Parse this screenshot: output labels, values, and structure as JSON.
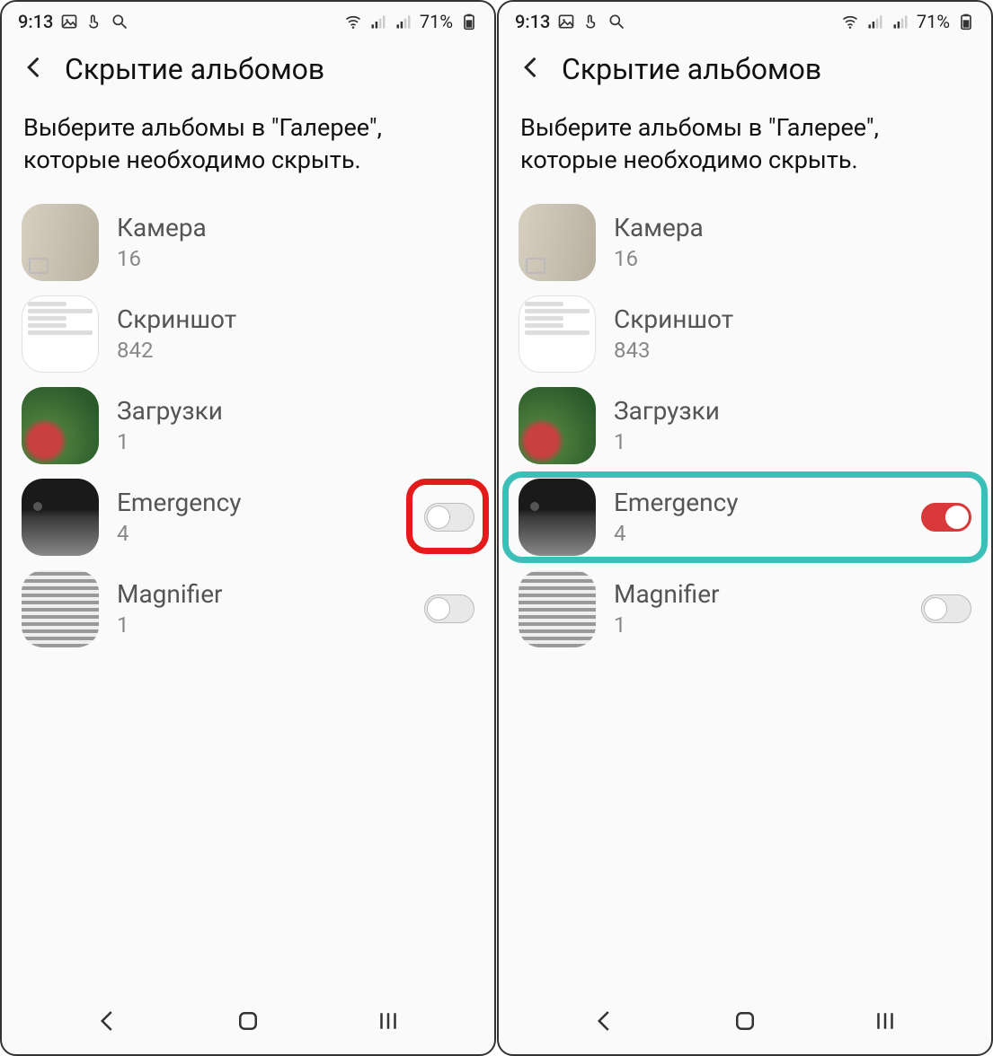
{
  "left": {
    "statusbar": {
      "time": "9:13",
      "battery": "71%"
    },
    "title": "Скрытие альбомов",
    "subtitle": "Выберите альбомы в \"Галерее\", которые необходимо скрыть.",
    "albums": [
      {
        "name": "Камера",
        "count": "16",
        "thumb": "camera",
        "toggle": null
      },
      {
        "name": "Скриншот",
        "count": "842",
        "thumb": "screenshot",
        "toggle": null
      },
      {
        "name": "Загрузки",
        "count": "1",
        "thumb": "downloads",
        "toggle": null
      },
      {
        "name": "Emergency",
        "count": "4",
        "thumb": "emergency",
        "toggle": "off"
      },
      {
        "name": "Magnifier",
        "count": "1",
        "thumb": "magnifier",
        "toggle": "off"
      }
    ]
  },
  "right": {
    "statusbar": {
      "time": "9:13",
      "battery": "71%"
    },
    "title": "Скрытие альбомов",
    "subtitle": "Выберите альбомы в \"Галерее\", которые необходимо скрыть.",
    "albums": [
      {
        "name": "Камера",
        "count": "16",
        "thumb": "camera",
        "toggle": null
      },
      {
        "name": "Скриншот",
        "count": "843",
        "thumb": "screenshot",
        "toggle": null
      },
      {
        "name": "Загрузки",
        "count": "1",
        "thumb": "downloads",
        "toggle": null
      },
      {
        "name": "Emergency",
        "count": "4",
        "thumb": "emergency",
        "toggle": "on"
      },
      {
        "name": "Magnifier",
        "count": "1",
        "thumb": "magnifier",
        "toggle": "off"
      }
    ]
  },
  "highlights": {
    "left": {
      "type": "red",
      "row": 3,
      "area": "toggle"
    },
    "right": {
      "type": "teal",
      "row": 3,
      "area": "row"
    }
  }
}
